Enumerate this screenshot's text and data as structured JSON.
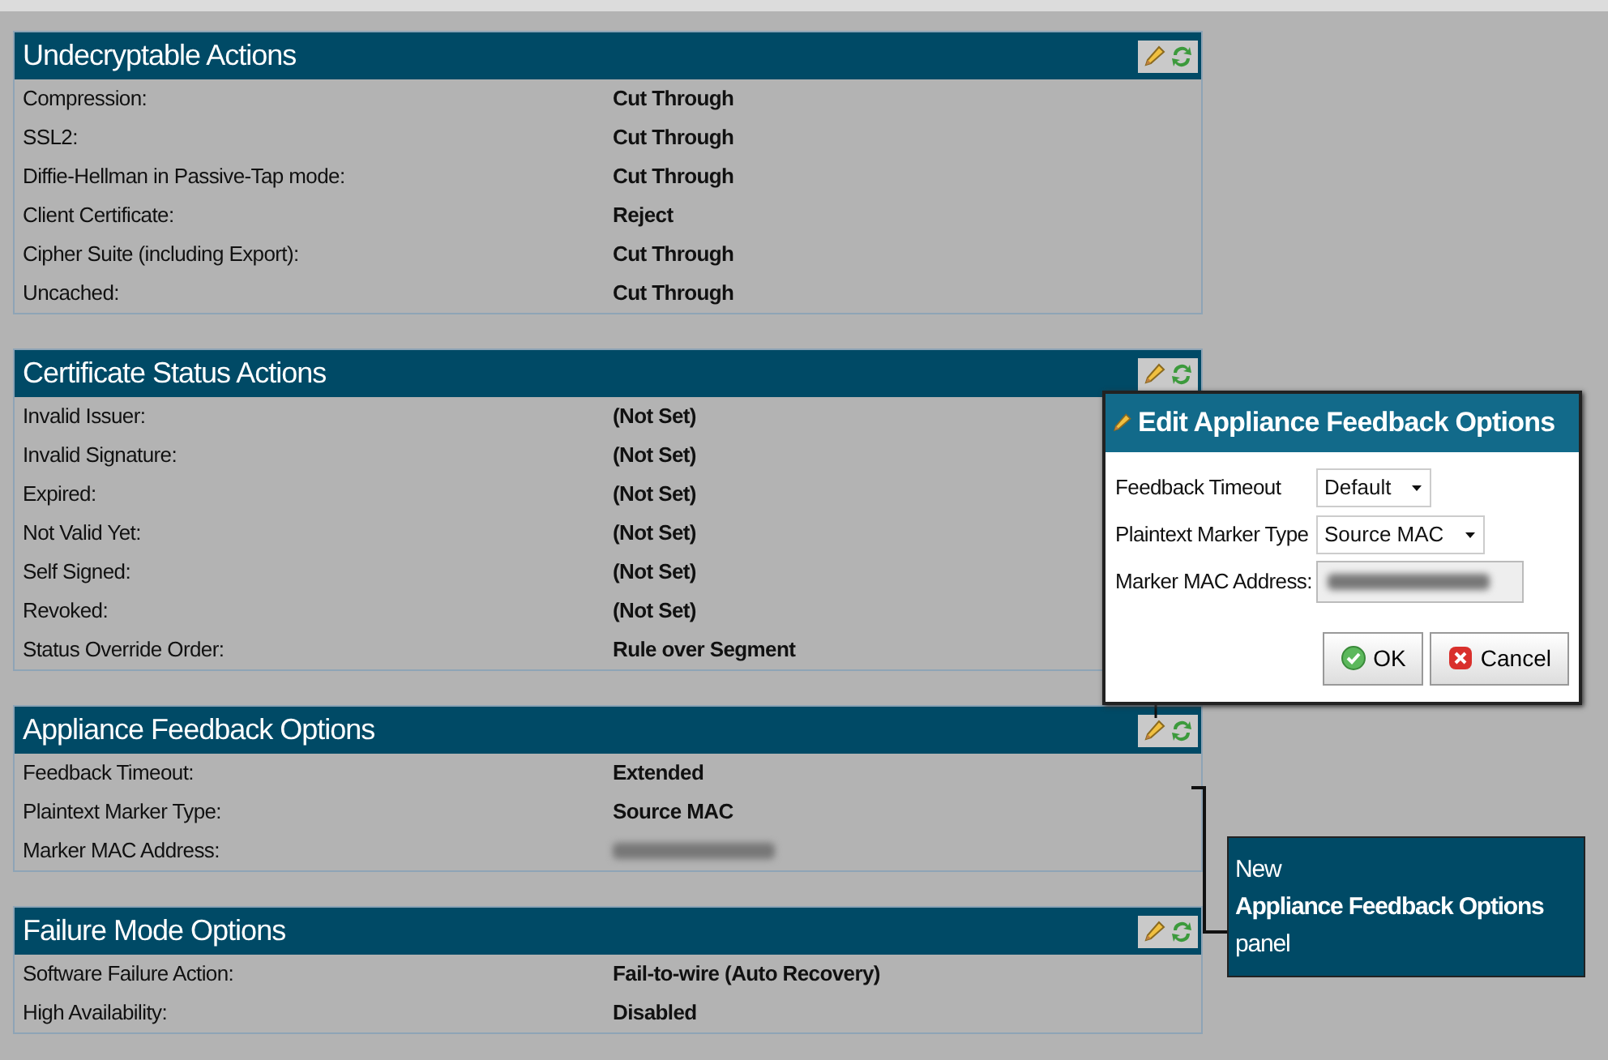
{
  "panels": [
    {
      "title": "Undecryptable Actions",
      "rows": [
        {
          "label": "Compression:",
          "value": "Cut Through"
        },
        {
          "label": "SSL2:",
          "value": "Cut Through"
        },
        {
          "label": "Diffie-Hellman in Passive-Tap mode:",
          "value": "Cut Through"
        },
        {
          "label": "Client Certificate:",
          "value": "Reject"
        },
        {
          "label": "Cipher Suite (including Export):",
          "value": "Cut Through"
        },
        {
          "label": "Uncached:",
          "value": "Cut Through"
        }
      ]
    },
    {
      "title": "Certificate Status Actions",
      "rows": [
        {
          "label": "Invalid Issuer:",
          "value": "(Not Set)"
        },
        {
          "label": "Invalid Signature:",
          "value": "(Not Set)"
        },
        {
          "label": "Expired:",
          "value": "(Not Set)"
        },
        {
          "label": "Not Valid Yet:",
          "value": "(Not Set)"
        },
        {
          "label": "Self Signed:",
          "value": "(Not Set)"
        },
        {
          "label": "Revoked:",
          "value": "(Not Set)"
        },
        {
          "label": "Status Override Order:",
          "value": "Rule over Segment"
        }
      ]
    },
    {
      "title": "Appliance Feedback Options",
      "rows": [
        {
          "label": "Feedback Timeout:",
          "value": "Extended"
        },
        {
          "label": "Plaintext Marker Type:",
          "value": "Source MAC"
        },
        {
          "label": "Marker MAC Address:",
          "redacted": true
        }
      ]
    },
    {
      "title": "Failure Mode Options",
      "rows": [
        {
          "label": "Software Failure Action:",
          "value": "Fail-to-wire (Auto Recovery)"
        },
        {
          "label": "High Availability:",
          "value": "Disabled"
        }
      ]
    }
  ],
  "dialog": {
    "title": "Edit Appliance Feedback Options",
    "fields": [
      {
        "kind": "select",
        "label": "Feedback Timeout",
        "value": "Default"
      },
      {
        "kind": "select",
        "label": "Plaintext Marker Type",
        "value": "Source MAC"
      },
      {
        "kind": "input",
        "label": "Marker MAC Address:",
        "redacted": true
      }
    ],
    "buttons": [
      {
        "kind": "ok",
        "label": "OK"
      },
      {
        "kind": "cancel",
        "label": "Cancel"
      }
    ]
  },
  "callout": {
    "text": "New\n**Appliance Feedback Options**\npanel"
  }
}
